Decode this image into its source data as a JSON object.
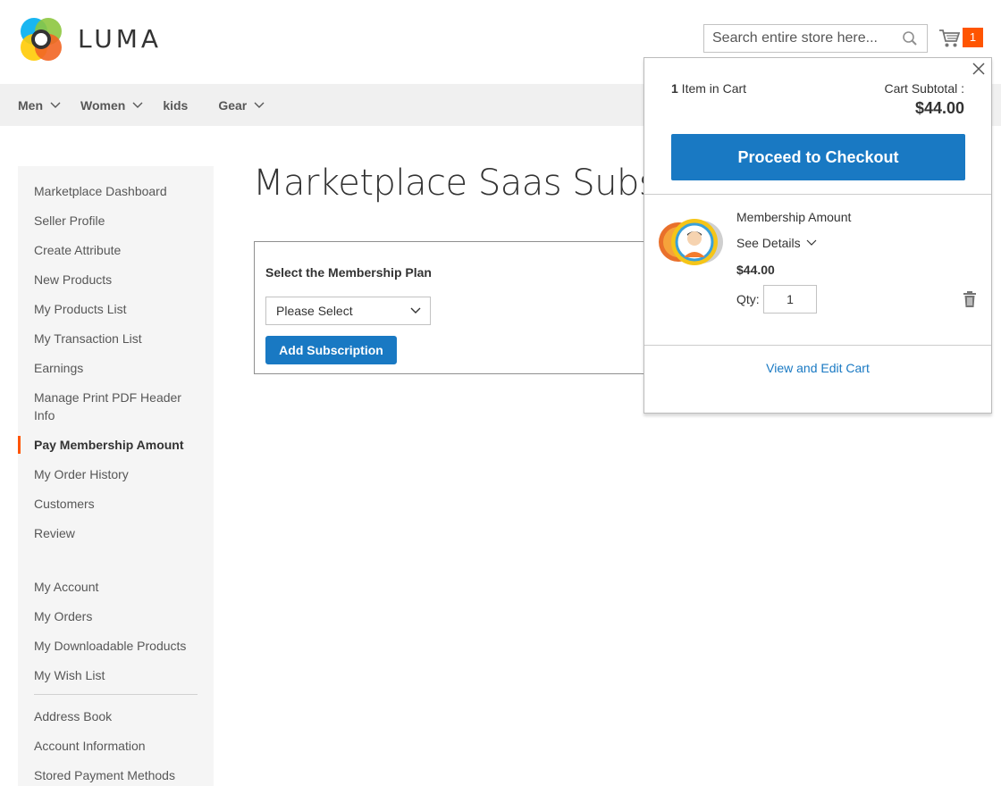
{
  "header": {
    "logo_text": "LUMA",
    "search_placeholder": "Search entire store here...",
    "cart_count": "1"
  },
  "nav": {
    "items": [
      {
        "label": "Men",
        "has_dropdown": true
      },
      {
        "label": "Women",
        "has_dropdown": true
      },
      {
        "label": "kids",
        "has_dropdown": false
      },
      {
        "label": "Gear",
        "has_dropdown": true
      }
    ]
  },
  "sidebar": {
    "group1": [
      "Marketplace Dashboard",
      "Seller Profile",
      "Create Attribute",
      "New Products",
      "My Products List",
      "My Transaction List",
      "Earnings",
      "Manage Print PDF Header Info",
      "Pay Membership Amount",
      "My Order History",
      "Customers",
      "Review"
    ],
    "active": "Pay Membership Amount",
    "group2": [
      "My Account",
      "My Orders",
      "My Downloadable Products",
      "My Wish List"
    ],
    "group3": [
      "Address Book",
      "Account Information",
      "Stored Payment Methods"
    ]
  },
  "main": {
    "page_title": "Marketplace Saas Subscription",
    "plan_label": "Select the Membership Plan",
    "plan_select_value": "Please Select",
    "add_button": "Add Subscription"
  },
  "minicart": {
    "count_number": "1",
    "count_text": " Item in Cart",
    "subtotal_label": "Cart Subtotal :",
    "subtotal_value": "$44.00",
    "checkout_label": "Proceed to Checkout",
    "item": {
      "name": "Membership Amount",
      "see_details": "See Details",
      "price": "$44.00",
      "qty_label": "Qty:",
      "qty_value": "1"
    },
    "view_cart": "View and Edit Cart"
  },
  "colors": {
    "accent": "#1979c3",
    "badge": "#ff5501",
    "nav_bg": "#f0f0f0",
    "sidebar_bg": "#f5f5f5"
  },
  "icons": [
    "luma-logo-icon",
    "search-icon",
    "cart-icon",
    "chevron-down-icon",
    "close-icon",
    "trash-icon"
  ]
}
